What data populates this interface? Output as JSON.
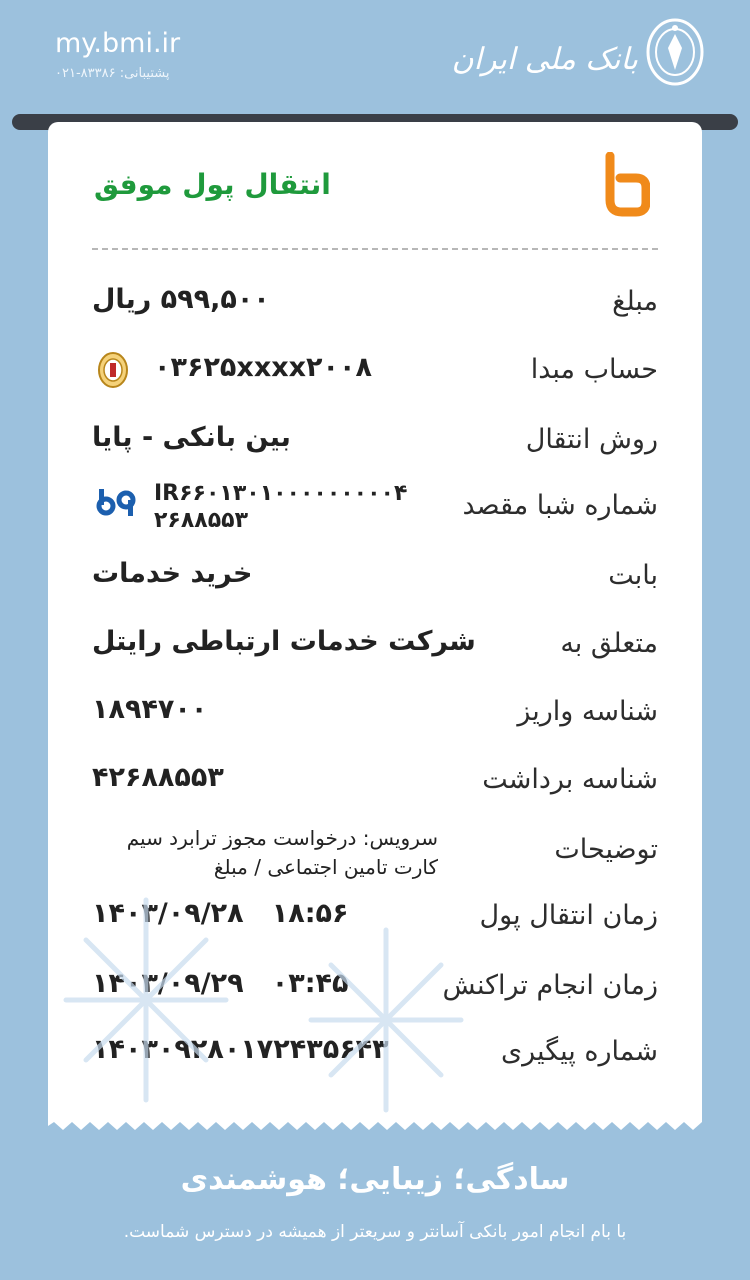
{
  "header": {
    "website": "my.bmi.ir",
    "support": "پشتیبانی: ۸۳۳۸۶-۰۲۱",
    "bank_name": "بانک ملی ایران"
  },
  "receipt": {
    "title": "انتقال پول موفق",
    "rows": [
      {
        "label": "مبلغ",
        "value": "۵۹۹,۵۰۰ ریال"
      },
      {
        "label": "حساب مبدا",
        "value": "۰۳۶۲۵xxxx۲۰۰۸"
      },
      {
        "label": "روش انتقال",
        "value": "بین بانکی - پایا"
      },
      {
        "label": "شماره شبا مقصد",
        "value": "IR۶۶۰۱۳۰۱۰۰۰۰۰۰۰۰۰۴ ۲۶۸۸۵۵۳"
      },
      {
        "label": "بابت",
        "value": "خرید خدمات"
      },
      {
        "label": "متعلق به",
        "value": "شرکت خدمات ارتباطی رایتل"
      },
      {
        "label": "شناسه واریز",
        "value": "۱۸۹۴۷۰۰"
      },
      {
        "label": "شناسه برداشت",
        "value": "۴۲۶۸۸۵۵۳"
      },
      {
        "label": "توضیحات",
        "value": "سرویس: درخواست مجوز ترابرد سیم کارت تامین اجتماعی / مبلغ"
      },
      {
        "label": "زمان انتقال پول",
        "value": "۱۴۰۳/۰۹/۲۸   ۱۸:۵۶"
      },
      {
        "label": "زمان انجام تراکنش",
        "value": "۱۴۰۳/۰۹/۲۹   ۰۳:۴۵"
      },
      {
        "label": "شماره پیگیری",
        "value": "۱۴۰۳۰۹۲۸۰۱۷۲۴۳۵۶۴۳"
      }
    ]
  },
  "footer": {
    "slogan": "سادگی؛ زیبایی؛ هوشمندی",
    "subtitle": "با بام انجام امور بانکی آسانتر و سریعتر از همیشه در دسترس شماست."
  },
  "icons": {
    "bank_logo": "bmi-emblem-icon",
    "app_logo": "bam-logo-icon",
    "source_bank": "bmi-small-icon",
    "dest_bank": "destination-bank-icon"
  },
  "colors": {
    "background": "#9cc1dd",
    "success": "#1f9a3c",
    "logo_orange": "#f08a1a",
    "dest_bank_blue": "#1c5fae"
  }
}
